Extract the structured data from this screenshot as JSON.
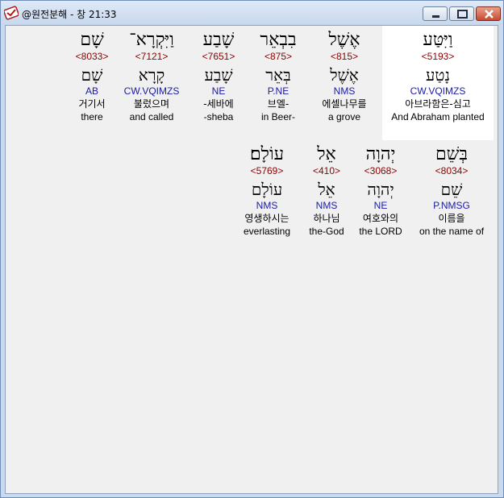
{
  "window": {
    "title": "@원전분해 - 창 21:33"
  },
  "rows": [
    {
      "words": [
        {
          "hebrew": "שָׁם",
          "strong": "<8033>",
          "lemma": "שָׁם",
          "morph": "AB",
          "korean": "거기서",
          "english": "there"
        },
        {
          "hebrew": "וַיִּקְרָא־",
          "strong": "<7121>",
          "lemma": "קָרָא",
          "morph": "CW.VQIMZS",
          "korean": "불렀으며",
          "english": "and called"
        },
        {
          "hebrew": "שָׁבַע",
          "strong": "<7651>",
          "lemma": "שָׁבַע",
          "morph": "NE",
          "korean": "-세바에",
          "english": "-sheba"
        },
        {
          "hebrew": "בִבְאֵר",
          "strong": "<875>",
          "lemma": "בְּאֵר",
          "morph": "P.NE",
          "korean": "브엘-",
          "english": "in Beer-"
        },
        {
          "hebrew": "אֶשֶׁל",
          "strong": "<815>",
          "lemma": "אֶשֶׁל",
          "morph": "NMS",
          "korean": "에셀나무를",
          "english": "a grove"
        },
        {
          "hebrew": "וַיִּטַּע",
          "strong": "<5193>",
          "lemma": "נָטַע",
          "morph": "CW.VQIMZS",
          "korean": "아브라함은-심고",
          "english": "And Abraham planted",
          "selected": true
        }
      ]
    },
    {
      "words": [
        {
          "hebrew": "עוֹלָם׃",
          "strong": "<5769>",
          "lemma": "עוֹלָם",
          "morph": "NMS",
          "korean": "영생하시는",
          "english": "everlasting"
        },
        {
          "hebrew": "אֵל",
          "strong": "<410>",
          "lemma": "אֵל",
          "morph": "NMS",
          "korean": "하나님",
          "english": "the-God"
        },
        {
          "hebrew": "יְהוָה",
          "strong": "<3068>",
          "lemma": "יְהוָה",
          "morph": "NE",
          "korean": "여호와의",
          "english": "the LORD"
        },
        {
          "hebrew": "בְּשֵׁם",
          "strong": "<8034>",
          "lemma": "שֵׁם",
          "morph": "P.NMSG",
          "korean": "이름을",
          "english": "on the name of"
        }
      ]
    }
  ],
  "colors": {
    "strong": "#8b0000",
    "morph": "#1a1aa6",
    "selected_bg": "#ffffff",
    "client_bg": "#f0f0f0"
  }
}
